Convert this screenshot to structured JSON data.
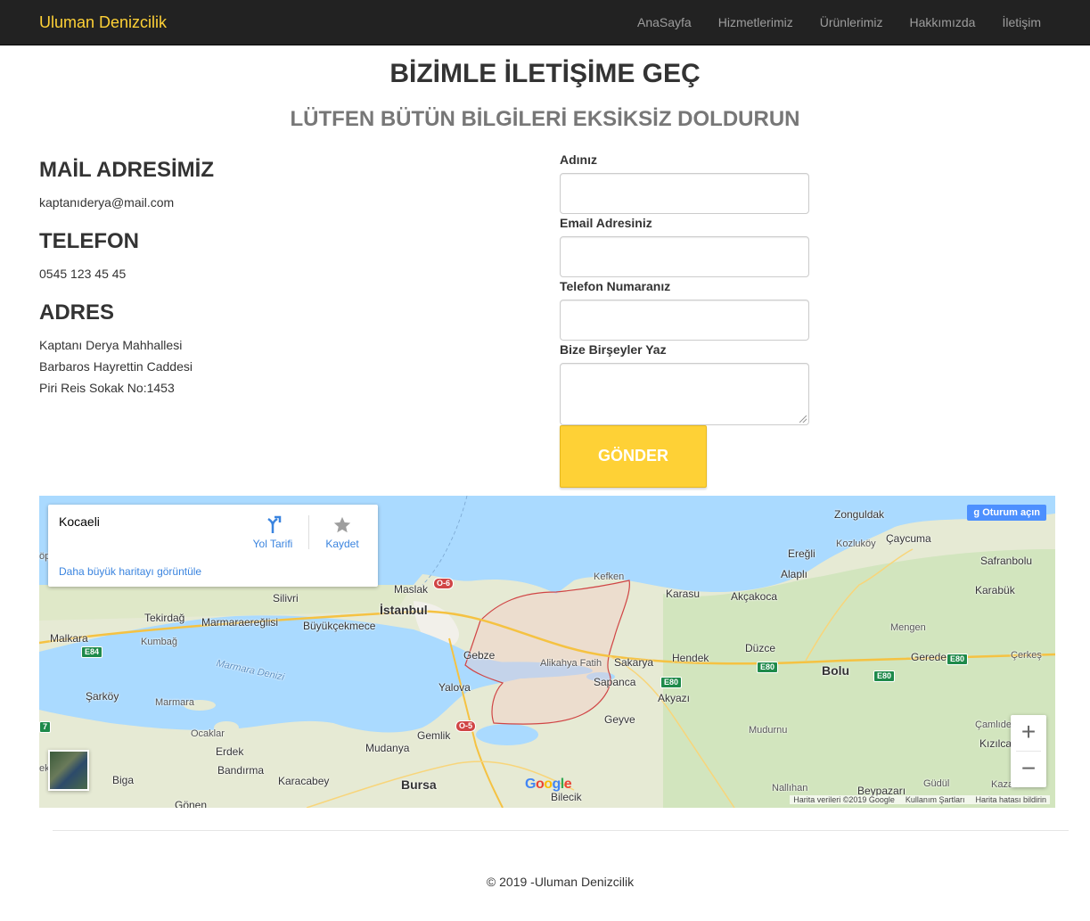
{
  "brand": "Uluman Denizcilik",
  "nav": [
    "AnaSayfa",
    "Hizmetlerimiz",
    "Ürünlerimiz",
    "Hakkımızda",
    "İletişim"
  ],
  "page_title": "BİZİMLE İLETİŞİME GEÇ",
  "page_subtitle": "LÜTFEN BÜTÜN BİLGİLERİ EKSİKSİZ DOLDURUN",
  "contact": {
    "mail_heading": "MAİL ADRESİMİZ",
    "mail": "kaptanıderya@mail.com",
    "phone_heading": "TELEFON",
    "phone": "0545 123 45 45",
    "address_heading": "ADRES",
    "address_lines": [
      "Kaptanı Derya Mahhallesi",
      "Barbaros Hayrettin Caddesi",
      "Piri Reis Sokak No:1453"
    ]
  },
  "form": {
    "name_label": "Adınız",
    "email_label": "Email Adresiniz",
    "phone_label": "Telefon Numaranız",
    "message_label": "Bize Birşeyler Yaz",
    "submit": "GÖNDER"
  },
  "map": {
    "place": "Kocaeli",
    "directions": "Yol Tarifi",
    "save": "Kaydet",
    "larger_map": "Daha büyük haritayı görüntüle",
    "sign_in": "Oturum açın",
    "google": "Google",
    "attribution": [
      "Harita verileri ©2019 Google",
      "Kullanım Şartları",
      "Harita hatası bildirin"
    ],
    "zoom_in": "+",
    "zoom_out": "−",
    "places": {
      "zonguldak": "Zonguldak",
      "eregli": "Ereğli",
      "kozlukoy": "Kozluköy",
      "caycuma": "Çaycuma",
      "safranbolu": "Safranbolu",
      "karabuk": "Karabük",
      "alapli": "Alaplı",
      "akcakoca": "Akçakoca",
      "karasu": "Karasu",
      "kefken": "Kefken",
      "maslak": "Maslak",
      "istanbul": "İstanbul",
      "silivri": "Silivri",
      "tekirdag": "Tekirdağ",
      "marmaraereglisi": "Marmaraereğlisi",
      "buyukcekmece": "Büyükçekmece",
      "malkara": "Malkara",
      "kumbag": "Kumbağ",
      "marmara_denizi": "Marmara Denizi",
      "gebze": "Gebze",
      "alikahya": "Alikahya Fatih",
      "sakarya": "Sakarya",
      "hendek": "Hendek",
      "duzce": "Düzce",
      "mengen": "Mengen",
      "gerede": "Gerede",
      "bolu": "Bolu",
      "cerkes": "Çerkeş",
      "yalova": "Yalova",
      "sapanca": "Sapanca",
      "akyazi": "Akyazı",
      "sarkoy": "Şarköy",
      "marmara": "Marmara",
      "geyve": "Geyve",
      "mudurnu": "Mudurnu",
      "camlidere": "Çamlıdere",
      "kizilcahamam": "Kızılcahama",
      "ocaklar": "Ocaklar",
      "erdek": "Erdek",
      "gemlik": "Gemlik",
      "mudanya": "Mudanya",
      "bandirma": "Bandırma",
      "biga": "Biga",
      "karacabey": "Karacabey",
      "bursa": "Bursa",
      "bilecik": "Bilecik",
      "nallihan": "Nallıhan",
      "beypazari": "Beypazarı",
      "gudul": "Güdül",
      "kazan": "Kazan",
      "gonen": "Gönen",
      "opa": "öpa",
      "ek": "ek"
    },
    "roads": [
      "O-6",
      "E84",
      "E80",
      "E80",
      "E80",
      "E80",
      "O-5",
      "7"
    ]
  },
  "footer": "© 2019 -Uluman Denizcilik",
  "colors": {
    "accent": "#fed136",
    "navbar": "#222222",
    "link": "#3a84df"
  }
}
